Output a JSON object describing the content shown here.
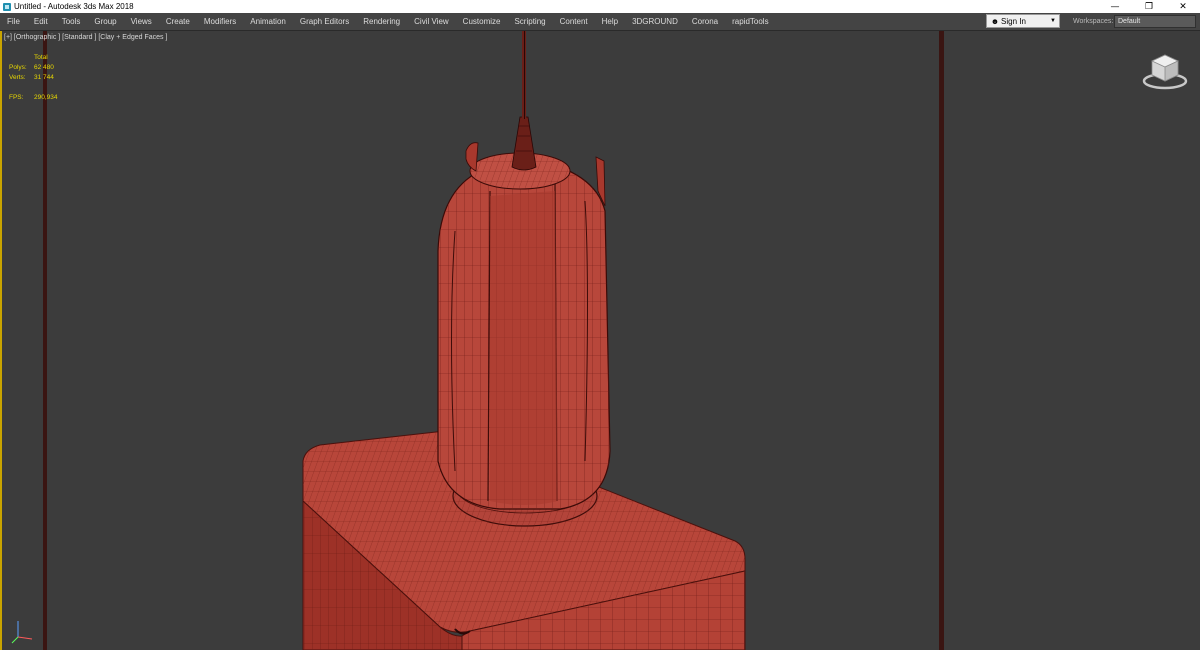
{
  "window": {
    "title": "Untitled - Autodesk 3ds Max 2018",
    "controls": {
      "minimize": "—",
      "restore": "❐",
      "close": "✕"
    }
  },
  "menu": [
    "File",
    "Edit",
    "Tools",
    "Group",
    "Views",
    "Create",
    "Modifiers",
    "Animation",
    "Graph Editors",
    "Rendering",
    "Civil View",
    "Customize",
    "Scripting",
    "Content",
    "Help",
    "3DGROUND",
    "Corona",
    "rapidTools"
  ],
  "account": {
    "signin_label": "Sign In",
    "icon": "user-icon",
    "caret": "▼"
  },
  "workspaces": {
    "label": "Workspaces:",
    "value": "Default"
  },
  "viewport": {
    "label": "[+] [Orthographic ] [Standard ] [Clay + Edged Faces ]",
    "stats": {
      "header": "Total",
      "polys_label": "Polys:",
      "polys_value": "62 480",
      "verts_label": "Verts:",
      "verts_value": "31 744",
      "fps_label": "FPS:",
      "fps_value": "290,934"
    },
    "colors": {
      "background": "#3c3c3c",
      "clay": "#b13b2e",
      "edges": "#5a1410",
      "stats_text": "#e8d800",
      "active_border": "#c9a400"
    }
  }
}
